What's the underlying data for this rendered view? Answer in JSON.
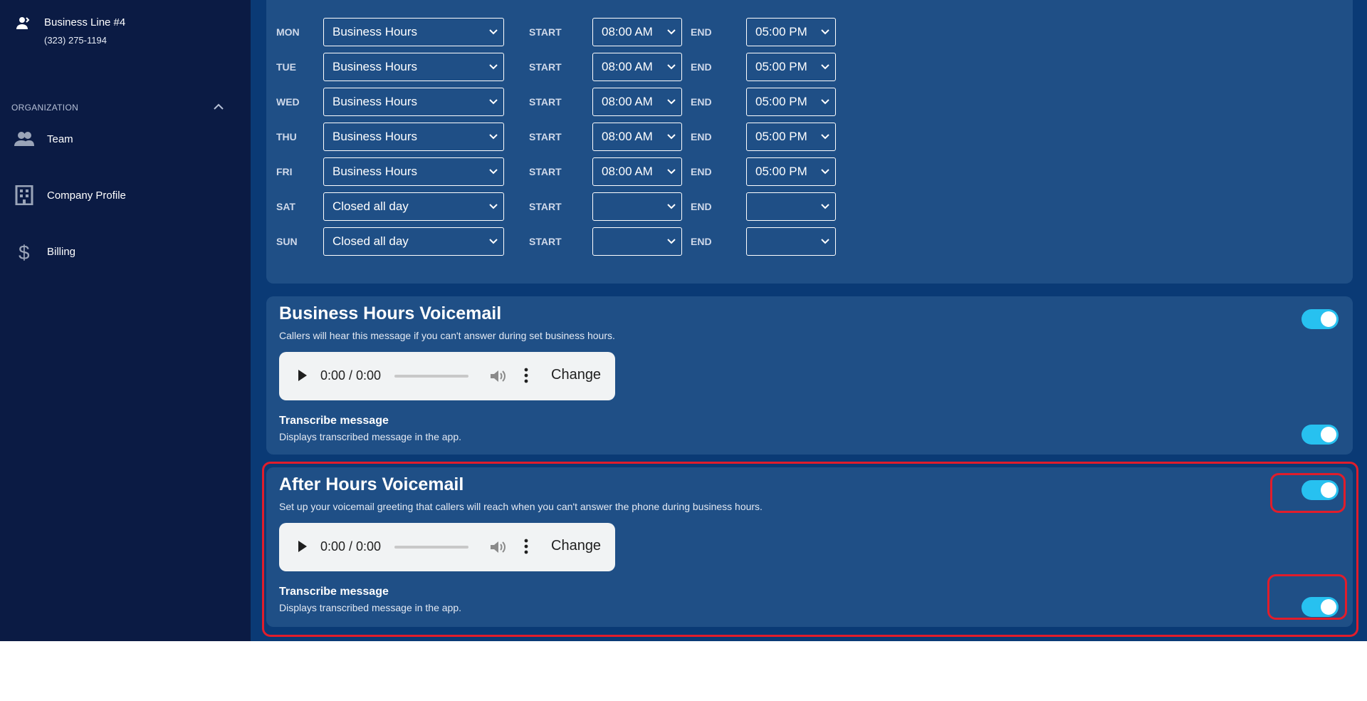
{
  "sidebar": {
    "line": {
      "name": "Business Line #4",
      "number": "(323) 275-1194"
    },
    "org_label": "ORGANIZATION",
    "items": [
      {
        "label": "Team",
        "icon": "team-icon"
      },
      {
        "label": "Company Profile",
        "icon": "building-icon"
      },
      {
        "label": "Billing",
        "icon": "dollar-icon"
      }
    ]
  },
  "schedule": {
    "start_label": "START",
    "end_label": "END",
    "rows": [
      {
        "day": "MON",
        "type": "Business Hours",
        "start": "08:00 AM",
        "end": "05:00 PM"
      },
      {
        "day": "TUE",
        "type": "Business Hours",
        "start": "08:00 AM",
        "end": "05:00 PM"
      },
      {
        "day": "WED",
        "type": "Business Hours",
        "start": "08:00 AM",
        "end": "05:00 PM"
      },
      {
        "day": "THU",
        "type": "Business Hours",
        "start": "08:00 AM",
        "end": "05:00 PM"
      },
      {
        "day": "FRI",
        "type": "Business Hours",
        "start": "08:00 AM",
        "end": "05:00 PM"
      },
      {
        "day": "SAT",
        "type": "Closed all day",
        "start": "",
        "end": ""
      },
      {
        "day": "SUN",
        "type": "Closed all day",
        "start": "",
        "end": ""
      }
    ]
  },
  "business_voicemail": {
    "title": "Business Hours Voicemail",
    "subtitle": "Callers will hear this message if you can't answer during set business hours.",
    "player_time": "0:00 / 0:00",
    "change_label": "Change",
    "transcribe_title": "Transcribe message",
    "transcribe_subtitle": "Displays transcribed message in the app."
  },
  "after_voicemail": {
    "title": "After Hours Voicemail",
    "subtitle": "Set up your voicemail greeting that callers will reach when you can't answer the phone during business hours.",
    "player_time": "0:00 / 0:00",
    "change_label": "Change",
    "transcribe_title": "Transcribe message",
    "transcribe_subtitle": "Displays transcribed message in the app."
  },
  "colors": {
    "sidebar": "#0b1b44",
    "content": "#0a3a75",
    "card": "#1f4f86",
    "toggle_on": "#27c1f0",
    "highlight": "#e11d2b"
  }
}
